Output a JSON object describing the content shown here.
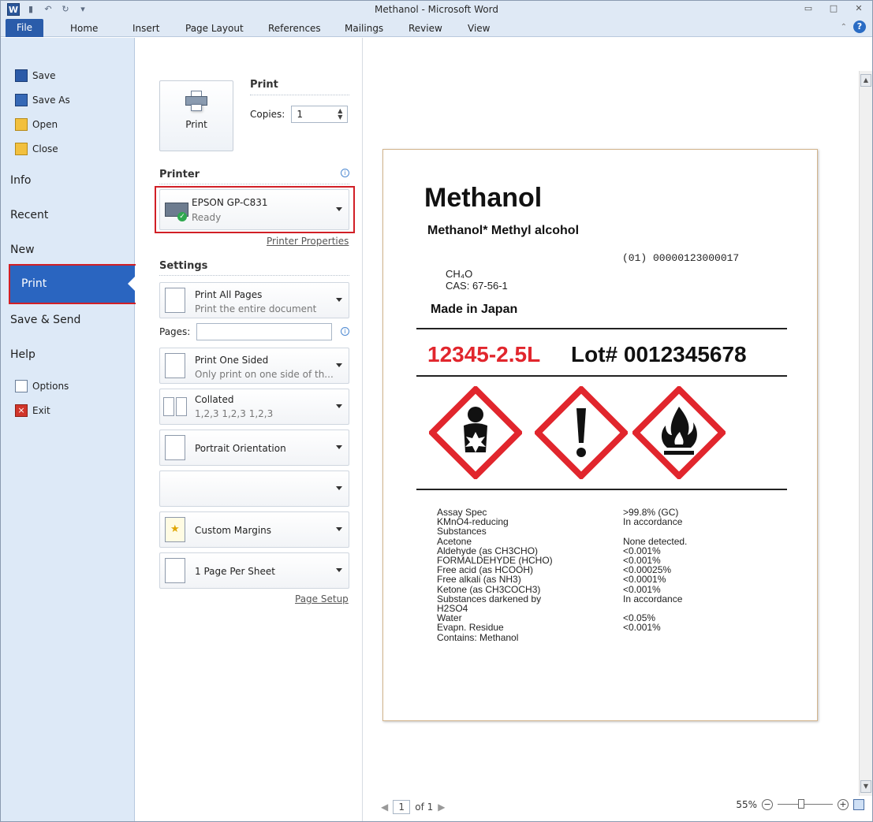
{
  "window": {
    "title": "Methanol - Microsoft Word",
    "app_icon_letter": "W"
  },
  "ribbon_tabs": [
    "File",
    "Home",
    "Insert",
    "Page Layout",
    "References",
    "Mailings",
    "Review",
    "View"
  ],
  "backstage_nav": {
    "save": "Save",
    "save_as": "Save As",
    "open": "Open",
    "close": "Close",
    "info": "Info",
    "recent": "Recent",
    "new": "New",
    "print": "Print",
    "save_send": "Save & Send",
    "help": "Help",
    "options": "Options",
    "exit": "Exit"
  },
  "print_panel": {
    "heading": "Print",
    "print_button": "Print",
    "copies_label": "Copies:",
    "copies_value": "1",
    "printer_heading": "Printer",
    "printer_name": "EPSON GP-C831",
    "printer_status": "Ready",
    "printer_properties": "Printer Properties",
    "settings_heading": "Settings",
    "print_range_main": "Print All Pages",
    "print_range_sub": "Print the entire document",
    "pages_label": "Pages:",
    "pages_value": "",
    "sided_main": "Print One Sided",
    "sided_sub": "Only print on one side of th...",
    "collate_main": "Collated",
    "collate_sub": "1,2,3   1,2,3   1,2,3",
    "orientation": "Portrait Orientation",
    "paper_size": "",
    "margins": "Custom Margins",
    "pages_per_sheet": "1 Page Per Sheet",
    "page_setup": "Page Setup"
  },
  "document": {
    "title": "Methanol",
    "subtitle": "Methanol* Methyl alcohol",
    "formula": "CH₄O",
    "cas": "CAS: 67-56-1",
    "barcode_text": "(01) 00000123000017",
    "made_in": "Made in Japan",
    "product_code": "12345-2.5L",
    "lot": "Lot# 0012345678",
    "hazard_pictograms": [
      "health-hazard",
      "exclamation-mark",
      "flame"
    ],
    "specs": [
      {
        "name": "Assay Spec",
        "value": ">99.8% (GC)"
      },
      {
        "name": "KMnO4-reducing",
        "value": "In accordance"
      },
      {
        "name": "Substances",
        "value": ""
      },
      {
        "name": "Acetone",
        "value": "None detected."
      },
      {
        "name": "Aldehyde (as CH3CHO)",
        "value": "<0.001%"
      },
      {
        "name": "FORMALDEHYDE (HCHO)",
        "value": "<0.001%"
      },
      {
        "name": "Free acid (as HCOOH)",
        "value": "<0.00025%"
      },
      {
        "name": "Free alkali (as NH3)",
        "value": "<0.0001%"
      },
      {
        "name": "Ketone (as CH3COCH3)",
        "value": "<0.001%"
      },
      {
        "name": "Substances darkened by",
        "value": "In accordance"
      },
      {
        "name": "H2SO4",
        "value": ""
      },
      {
        "name": "Water",
        "value": "<0.05%"
      },
      {
        "name": "Evapn. Residue",
        "value": "<0.001%"
      },
      {
        "name": "Contains: Methanol",
        "value": ""
      }
    ]
  },
  "page_nav": {
    "current": "1",
    "of_label": "of 1"
  },
  "zoom": {
    "level": "55%",
    "slider_fraction": 0.42
  },
  "colors": {
    "file_tab": "#2a5caa",
    "print_selected": "#2a65c0",
    "highlight_box": "#d11f26",
    "product_code": "#e1262d",
    "ghs_red": "#e1262d"
  }
}
